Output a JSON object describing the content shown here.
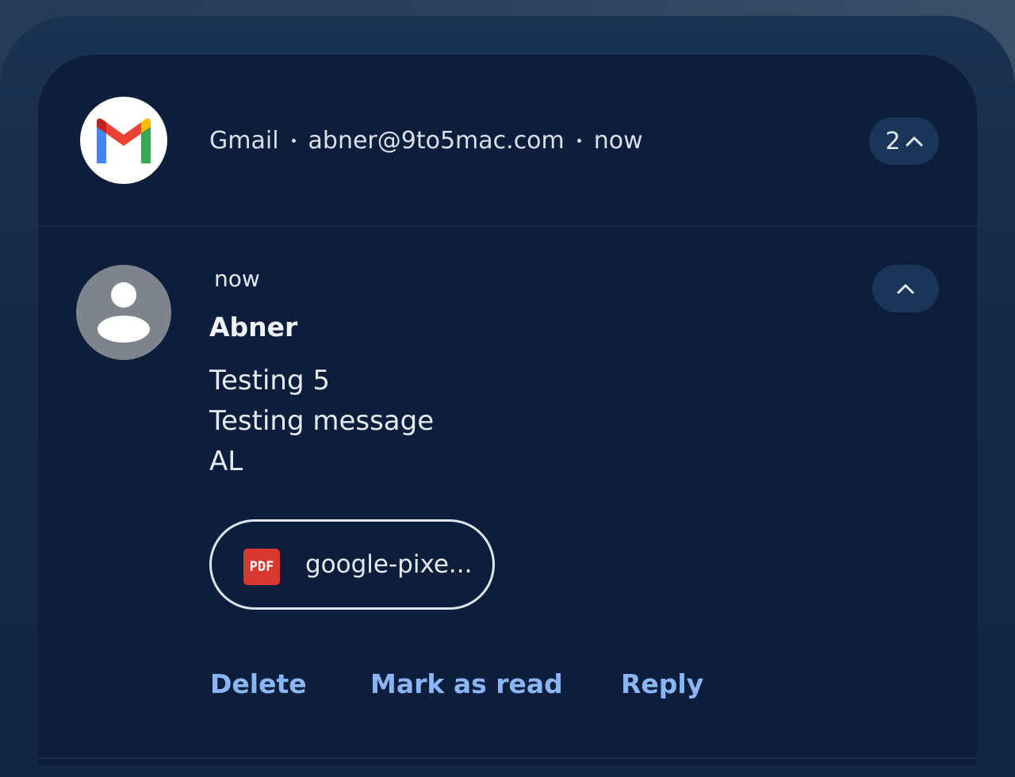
{
  "header": {
    "app_name": "Gmail",
    "account": "abner@9to5mac.com",
    "time": "now",
    "count": "2"
  },
  "message": {
    "time": "now",
    "sender": "Abner",
    "lines": [
      "Testing 5",
      "Testing message",
      "AL"
    ]
  },
  "attachment": {
    "type_label": "PDF",
    "name": "google-pixe..."
  },
  "actions": {
    "delete": "Delete",
    "mark_read": "Mark as read",
    "reply": "Reply"
  },
  "colors": {
    "card_bg": "#0c1e3b",
    "action_text": "#8ab6f5",
    "pill_bg": "#1b3558",
    "pdf_red": "#d8382d"
  },
  "icons": {
    "app": "gmail-logo-icon",
    "avatar": "person-avatar-icon",
    "expand": "chevron-up-icon",
    "attachment": "pdf-icon"
  }
}
